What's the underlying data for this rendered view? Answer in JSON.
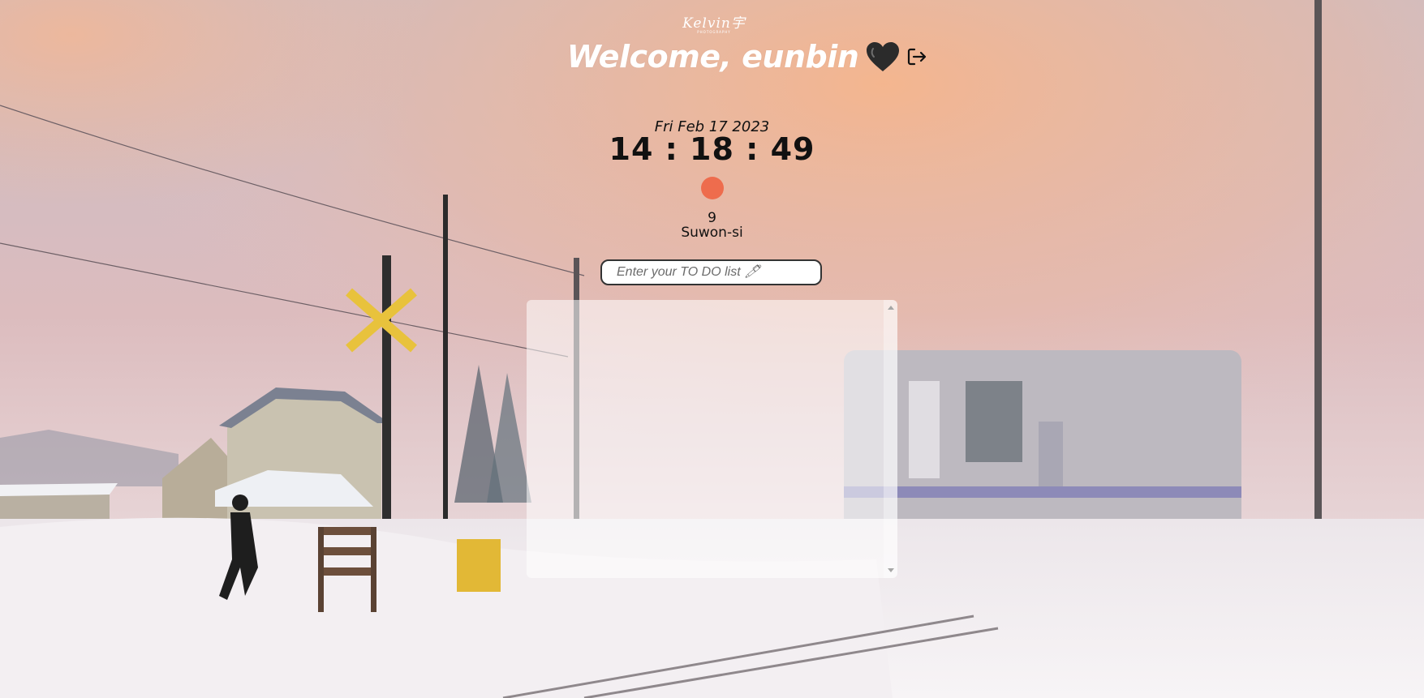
{
  "logo": {
    "text": "Kelvin宇",
    "subtext": "PHOTOGRAPHY"
  },
  "greeting": {
    "text": "Welcome, eunbin"
  },
  "icons": {
    "heart": "black-heart-icon",
    "logout": "logout-icon",
    "pencil": "pencil-icon"
  },
  "clock": {
    "date": "Fri Feb 17 2023",
    "time": "14 : 18 : 49"
  },
  "weather": {
    "temperature": "9",
    "city": "Suwon-si",
    "indicator_color": "#ee6c4d"
  },
  "todo": {
    "placeholder": "Enter your TO DO list 🖊",
    "value": "",
    "items": []
  },
  "colors": {
    "heart": "#2b2b2b",
    "sky_top": "#cbbfc6",
    "sky_glow": "#f3b896",
    "snow": "#f4f0f3"
  }
}
